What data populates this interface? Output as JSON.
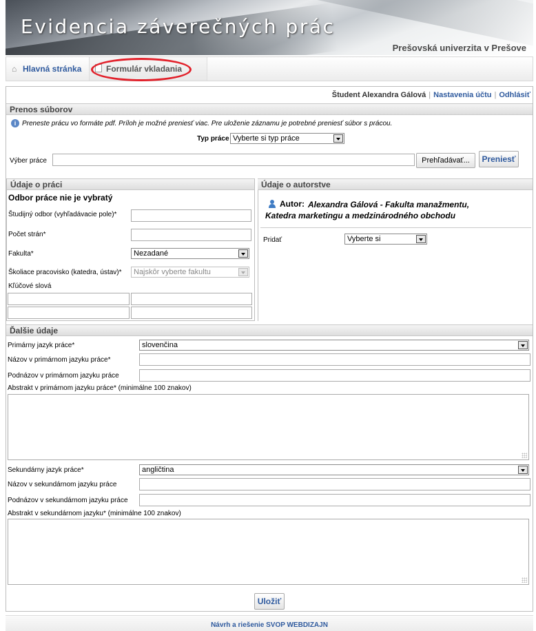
{
  "header": {
    "title": "Evidencia záverečných prác",
    "university": "Prešovská univerzita v Prešove"
  },
  "nav": {
    "home": "Hlavná stránka",
    "form": "Formulár vkladania"
  },
  "userbar": {
    "student": "Študent Alexandra Gálová",
    "settings": "Nastavenia účtu",
    "logout": "Odhlásiť"
  },
  "upload": {
    "heading": "Prenos súborov",
    "info": "Preneste prácu vo formáte pdf. Príloh je možné preniesť viac. Pre uloženie záznamu je potrebné preniesť súbor s prácou.",
    "type_label": "Typ práce",
    "type_value": "Vyberte si typ práce",
    "file_label": "Výber práce",
    "browse": "Prehľadávať...",
    "transfer": "Preniesť"
  },
  "work": {
    "heading": "Údaje o práci",
    "subheading": "Odbor práce nie je vybratý",
    "field_study": "Študijný odbor (vyhľadávacie pole)*",
    "pages": "Počet strán*",
    "faculty": "Fakulta*",
    "faculty_value": "Nezadané",
    "dept": "Školiace pracovisko (katedra, ústav)*",
    "dept_value": "Najskôr vyberte fakultu",
    "keywords": "Kľúčové slová"
  },
  "authorship": {
    "heading": "Údaje o autorstve",
    "author_label": "Autor:",
    "author_value": "Alexandra Gálová - Fakulta manažmentu, Katedra marketingu a medzinárodného obchodu",
    "add_label": "Pridať",
    "add_value": "Vyberte si"
  },
  "other": {
    "heading": "Ďalšie údaje",
    "primary_lang": "Primárny jazyk práce*",
    "primary_lang_value": "slovenčina",
    "title_primary": "Názov v primárnom jazyku práce*",
    "subtitle_primary": "Podnázov v primárnom jazyku práce",
    "abstract_primary": "Abstrakt v primárnom jazyku práce* (minimálne 100 znakov)",
    "secondary_lang": "Sekundárny jazyk práce*",
    "secondary_lang_value": "angličtina",
    "title_secondary": "Názov v sekundárnom jazyku práce",
    "subtitle_secondary": "Podnázov v sekundárnom jazyku práce",
    "abstract_secondary": "Abstrakt v sekundárnom jazyku* (minimálne 100 znakov)",
    "save": "Uložiť"
  },
  "footer": "Návrh a riešenie SVOP WEBDIZAJN",
  "colors": {
    "link": "#2f5a9e",
    "highlight": "#e2202a"
  }
}
